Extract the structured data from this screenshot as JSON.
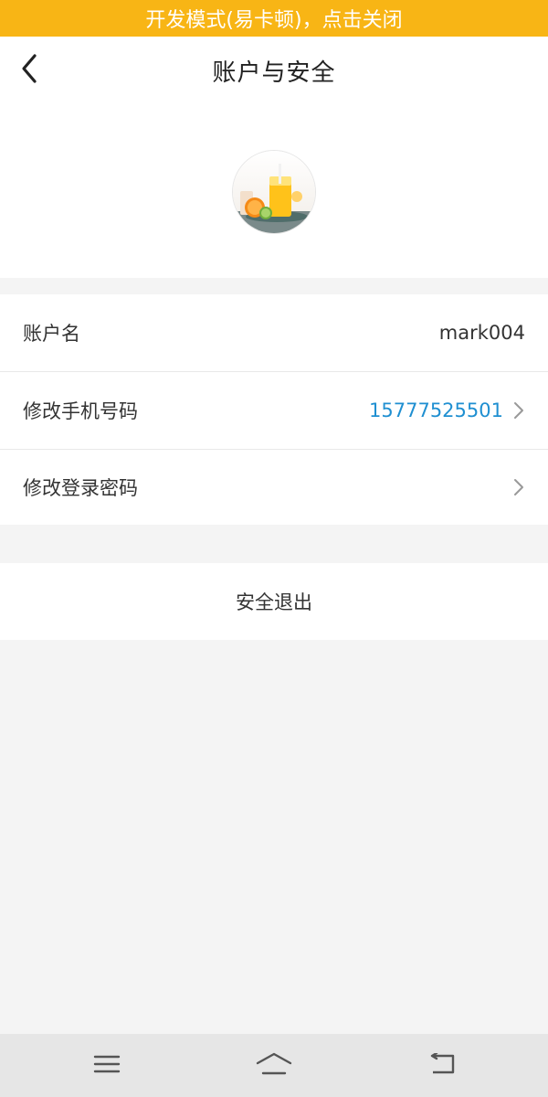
{
  "dev_banner": {
    "text": "开发模式(易卡顿)，点击关闭"
  },
  "header": {
    "title": "账户与安全",
    "back_icon": "chevron-left-icon"
  },
  "avatar": {
    "alt": "avatar"
  },
  "account": {
    "rows": [
      {
        "label": "账户名",
        "value": "mark004"
      },
      {
        "label": "修改手机号码",
        "value": "15777525501"
      },
      {
        "label": "修改登录密码",
        "value": ""
      }
    ],
    "phone_color": "#1f8fd1"
  },
  "logout": {
    "label": "安全退出"
  },
  "colors": {
    "banner": "#f8b515",
    "background": "#f4f4f4"
  },
  "navbar": {
    "icons": [
      "menu-icon",
      "home-icon",
      "back-icon"
    ]
  }
}
